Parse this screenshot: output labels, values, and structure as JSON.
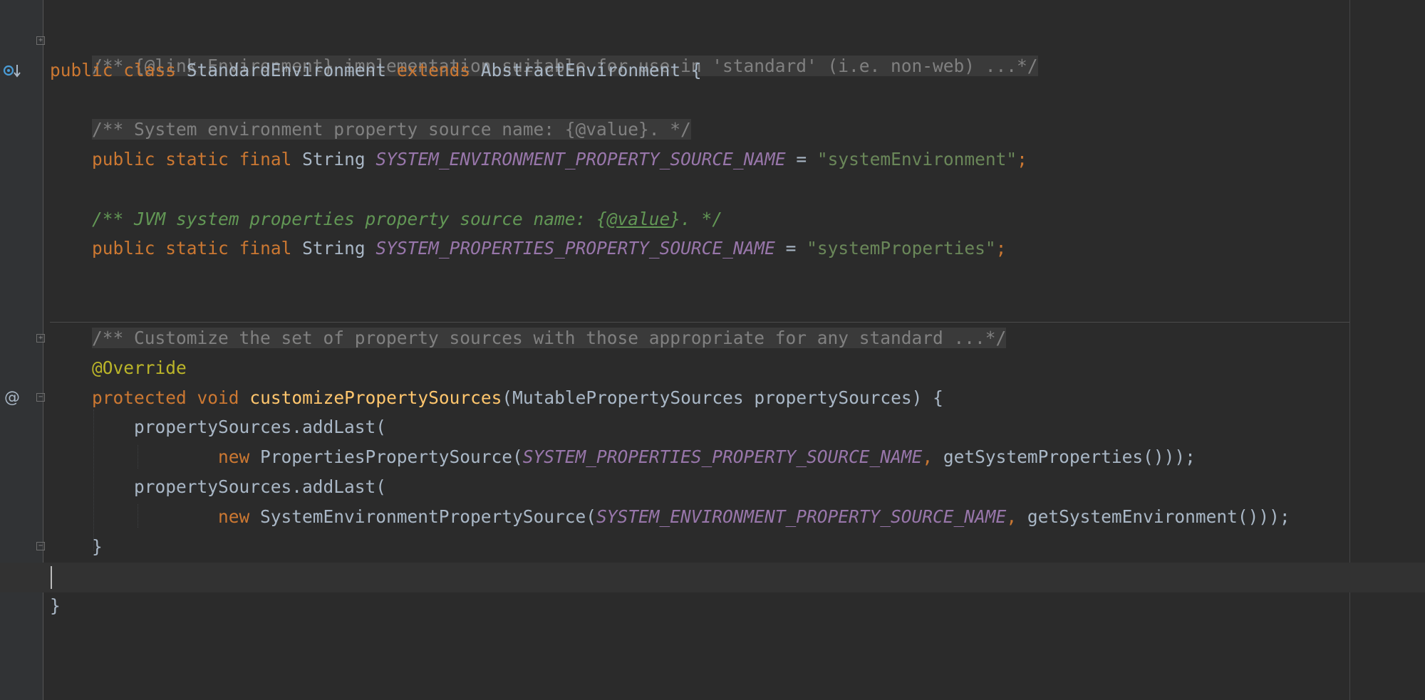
{
  "gutter": {
    "implements_icon": "implemented-class-arrow-icon",
    "override_icon": "override-at-icon"
  },
  "code": {
    "l1": {
      "t0": "/** {@link Environment} implementation suitable for use in 'standard' (i.e. non-web) ...*/"
    },
    "l2": {
      "t0": "public",
      "t1": " ",
      "t2": "class",
      "t3": " StandardEnvironment ",
      "t4": "extends",
      "t5": " AbstractEnvironment {"
    },
    "l4": {
      "t0": "    ",
      "t1": "/** System environment property source name: {@value}. */"
    },
    "l5": {
      "t0": "    ",
      "t1": "public",
      "t2": " ",
      "t3": "static",
      "t4": " ",
      "t5": "final",
      "t6": " String ",
      "t7": "SYSTEM_ENVIRONMENT_PROPERTY_SOURCE_NAME",
      "t8": " = ",
      "t9": "\"systemEnvironment\"",
      "t10": ";"
    },
    "l7": {
      "t0": "    ",
      "t1": "/** JVM system properties property source name: {",
      "t2": "@value",
      "t3": "}. */"
    },
    "l8": {
      "t0": "    ",
      "t1": "public",
      "t2": " ",
      "t3": "static",
      "t4": " ",
      "t5": "final",
      "t6": " String ",
      "t7": "SYSTEM_PROPERTIES_PROPERTY_SOURCE_NAME",
      "t8": " = ",
      "t9": "\"systemProperties\"",
      "t10": ";"
    },
    "l11": {
      "t0": "    ",
      "t1": "/** Customize the set of property sources with those appropriate for any standard ...*/"
    },
    "l12": {
      "t0": "    ",
      "t1": "@Override"
    },
    "l13": {
      "t0": "    ",
      "t1": "protected",
      "t2": " ",
      "t3": "void",
      "t4": " ",
      "t5": "customizePropertySources",
      "t6": "(MutablePropertySources propertySources) {"
    },
    "l14": {
      "t0": "        propertySources.addLast("
    },
    "l15": {
      "t0": "                ",
      "t1": "new",
      "t2": " PropertiesPropertySource(",
      "t3": "SYSTEM_PROPERTIES_PROPERTY_SOURCE_NAME",
      "t4": ", ",
      "t5": "getSystemProperties()));"
    },
    "l16": {
      "t0": "        propertySources.addLast("
    },
    "l17": {
      "t0": "                ",
      "t1": "new",
      "t2": " SystemEnvironmentPropertySource(",
      "t3": "SYSTEM_ENVIRONMENT_PROPERTY_SOURCE_NAME",
      "t4": ", ",
      "t5": "getSystemEnvironment()));"
    },
    "l18": {
      "t0": "    }"
    },
    "l20": {
      "t0": "}"
    }
  },
  "colors": {
    "background": "#2b2b2b",
    "keyword": "#cc7832",
    "constant": "#9876aa",
    "string": "#6a8759",
    "comment": "#808080",
    "doc_comment": "#629755",
    "annotation": "#bbb529",
    "method_declaration": "#ffc66d",
    "text": "#a9b7c6"
  }
}
